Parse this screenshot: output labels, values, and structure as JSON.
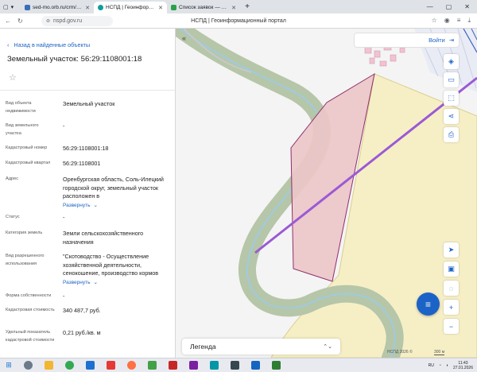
{
  "browser": {
    "tabs": [
      {
        "title": "sed-mo.orb.ru/crm/web/",
        "color": "#3b6fb6"
      },
      {
        "title": "НСПД | Геоинформационный",
        "color": "#0e9d9a"
      },
      {
        "title": "Список заявок — Технол.",
        "color": "#2aa14b"
      }
    ],
    "new_tab": "+",
    "url": "nspd.gov.ru",
    "page_title": "НСПД | Геоинформационный портал"
  },
  "panel": {
    "back_label": "Назад в найденные объекты",
    "title": "Земельный участок: 56:29:1108001:18",
    "rows": [
      {
        "label": "Вид объекта недвижимости",
        "value": "Земельный участок"
      },
      {
        "label": "Вид земельного участка",
        "value": "-"
      },
      {
        "label": "Кадастровый номер",
        "value": "56:29:1108001:18"
      },
      {
        "label": "Кадастровый квартал",
        "value": "56:29:1108001"
      },
      {
        "label": "Адрес",
        "value": "Оренбургская область, Соль-Илецкий городской округ, земельный участок расположен в",
        "more": "Развернуть"
      },
      {
        "label": "Статус",
        "value": "-"
      },
      {
        "label": "Категория земель",
        "value": "Земли сельскохозяйственного назначения"
      },
      {
        "label": "Вид разрешенного использования",
        "value": "\"Скотоводство - Осуществление хозяйственной деятельности, сенокошение, производство кормов",
        "more": "Развернуть"
      },
      {
        "label": "Форма собственности",
        "value": "-"
      },
      {
        "label": "Кадастровая стоимость",
        "value": "340 487,7 руб."
      },
      {
        "label": "Удельный показатель кадастровой стоимости",
        "value": "0,21 руб./кв. м"
      }
    ]
  },
  "map": {
    "login_label": "Войти",
    "legend_label": "Легенда",
    "attribution": "НСПД 2026 ©",
    "scale": "300 м",
    "colors": {
      "river": "#b6c6a8",
      "parcel_fill": "#ecc6c8",
      "parcel_border": "#8e2f6b",
      "line": "#9b59d6",
      "zone": "#f6efc6",
      "accent": "#1b63c6"
    }
  },
  "taskbar": {
    "time": "11:43",
    "date": "27.01.2026",
    "lang": "RU"
  }
}
